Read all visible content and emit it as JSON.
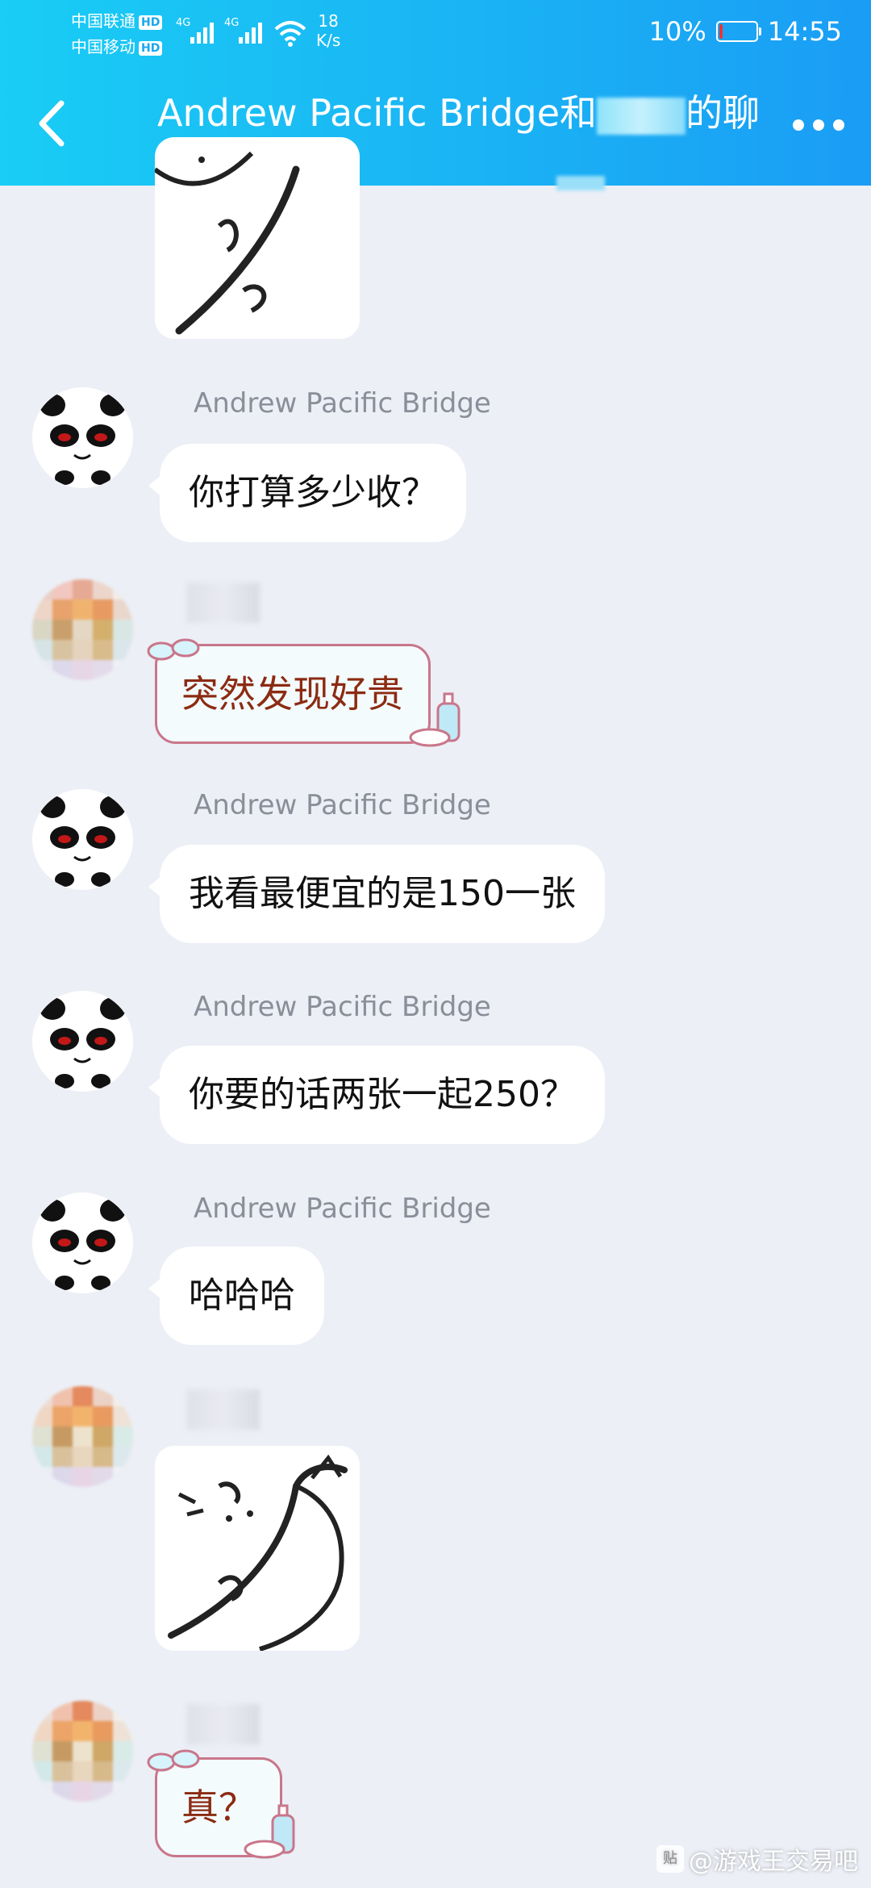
{
  "status_bar": {
    "carrier1": "中国联通",
    "carrier2": "中国移动",
    "hd": "HD",
    "net_type": "4G",
    "speed_value": "18",
    "speed_unit": "K/s",
    "battery_text": "10%",
    "battery_level": 0.1,
    "time": "14:55"
  },
  "header": {
    "title_prefix": "Andrew Pacific Bridge和",
    "title_suffix": "的聊"
  },
  "messages": [
    {
      "sender": "Andrew Pacific Bridge",
      "text": "你打算多少收？"
    },
    {
      "text": "突然发现好贵"
    },
    {
      "sender": "Andrew Pacific Bridge",
      "text": "我看最便宜的是150一张"
    },
    {
      "sender": "Andrew Pacific Bridge",
      "text": "你要的话两张一起250？"
    },
    {
      "sender": "Andrew Pacific Bridge",
      "text": "哈哈哈"
    },
    {
      "text": "真？"
    }
  ],
  "watermark": "@游戏王交易吧",
  "colors": {
    "header_start": "#19cdf5",
    "header_end": "#1a9df5",
    "chat_bg": "#eceff6",
    "deco_text": "#8c2b12"
  }
}
